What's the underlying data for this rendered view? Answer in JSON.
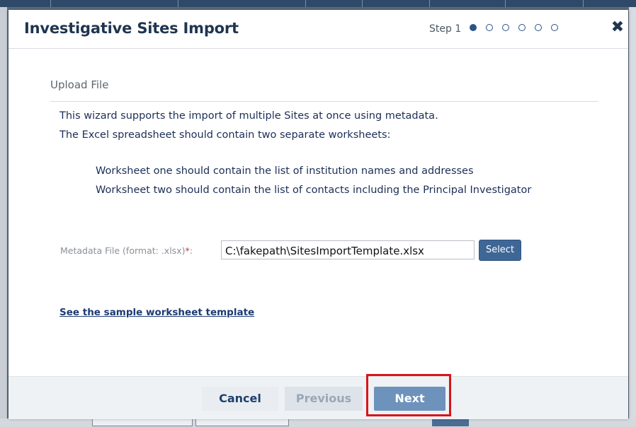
{
  "dialog": {
    "title": "Investigative Sites Import",
    "step_label": "Step 1",
    "steps_total": 6,
    "current_step": 1,
    "close_symbol": "✖"
  },
  "section": {
    "title": "Upload File"
  },
  "description": {
    "line1": "This wizard supports the import of multiple Sites at once using metadata.",
    "line2": "The Excel spreadsheet should contain two separate worksheets:",
    "bullet1": "Worksheet one should contain the list of institution names and addresses",
    "bullet2": "Worksheet two should contain the list of contacts including the Principal Investigator"
  },
  "metadata_field": {
    "label": "Metadata File (format: .xlsx)",
    "required_mark": "*",
    "colon": ":",
    "value": "C:\\fakepath\\SitesImportTemplate.xlsx",
    "select_label": "Select"
  },
  "sample_link": "See the sample worksheet template",
  "footer": {
    "cancel_label": "Cancel",
    "previous_label": "Previous",
    "next_label": "Next"
  },
  "colors": {
    "title": "#1f3550",
    "accent": "#2d5286",
    "next_button": "#6d92bc",
    "highlight": "#d9141b"
  }
}
